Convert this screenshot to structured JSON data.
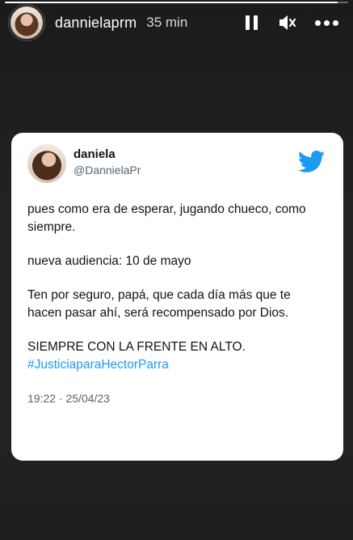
{
  "story": {
    "username": "dannielaprm",
    "time_ago": "35 min",
    "progress_fraction": 0.97
  },
  "controls": {
    "pause_icon": "pause-icon",
    "mute_icon": "speaker-muted-icon",
    "more_icon": "more-horizontal-icon"
  },
  "tweet": {
    "display_name": "daniela",
    "handle": "@DannielaPr",
    "brand_color": "#1d9bf0",
    "paragraphs": [
      "pues como era de esperar, jugando chueco, como siempre.",
      "nueva audiencia: 10 de mayo",
      "Ten por seguro, papá, que cada día más que te hacen pasar ahí, será recompensado por Dios.",
      "SIEMPRE CON LA FRENTE EN ALTO."
    ],
    "hashtag": "#JusticiaparaHectorParra",
    "timestamp": "19:22 · 25/04/23"
  }
}
